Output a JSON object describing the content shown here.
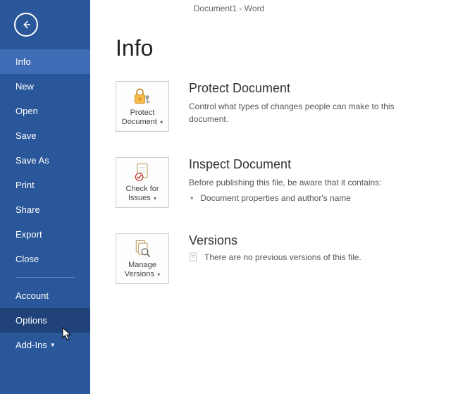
{
  "titlebar": "Document1 - Word",
  "sidebar": {
    "items": [
      {
        "label": "Info",
        "selected": true
      },
      {
        "label": "New"
      },
      {
        "label": "Open"
      },
      {
        "label": "Save"
      },
      {
        "label": "Save As"
      },
      {
        "label": "Print"
      },
      {
        "label": "Share"
      },
      {
        "label": "Export"
      },
      {
        "label": "Close"
      }
    ],
    "footerItems": [
      {
        "label": "Account"
      },
      {
        "label": "Options",
        "hover": true
      },
      {
        "label": "Add-Ins",
        "dropdown": true
      }
    ]
  },
  "page": {
    "title": "Info",
    "sections": {
      "protect": {
        "buttonLabel": "Protect Document",
        "title": "Protect Document",
        "desc": "Control what types of changes people can make to this document."
      },
      "inspect": {
        "buttonLabel": "Check for Issues",
        "title": "Inspect Document",
        "desc": "Before publishing this file, be aware that it contains:",
        "items": [
          "Document properties and author's name"
        ]
      },
      "versions": {
        "buttonLabel": "Manage Versions",
        "title": "Versions",
        "noneText": "There are no previous versions of this file."
      }
    }
  }
}
